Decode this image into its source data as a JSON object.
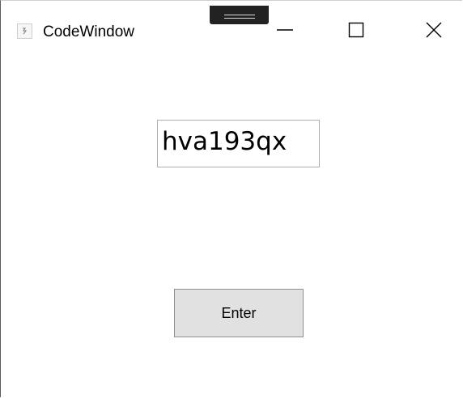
{
  "window": {
    "title": "CodeWindow",
    "icons": {
      "app": "app-icon",
      "grip": "drag-grip-icon",
      "minimize": "minimize-icon",
      "maximize": "maximize-icon",
      "close": "close-icon"
    }
  },
  "form": {
    "code_value": "hva193qx",
    "enter_label": "Enter"
  },
  "colors": {
    "window_background": "#ffffff",
    "button_background": "#e1e1e1",
    "button_border": "#8f8f8f",
    "input_border": "#aeaeae",
    "grip_background": "#222222"
  }
}
